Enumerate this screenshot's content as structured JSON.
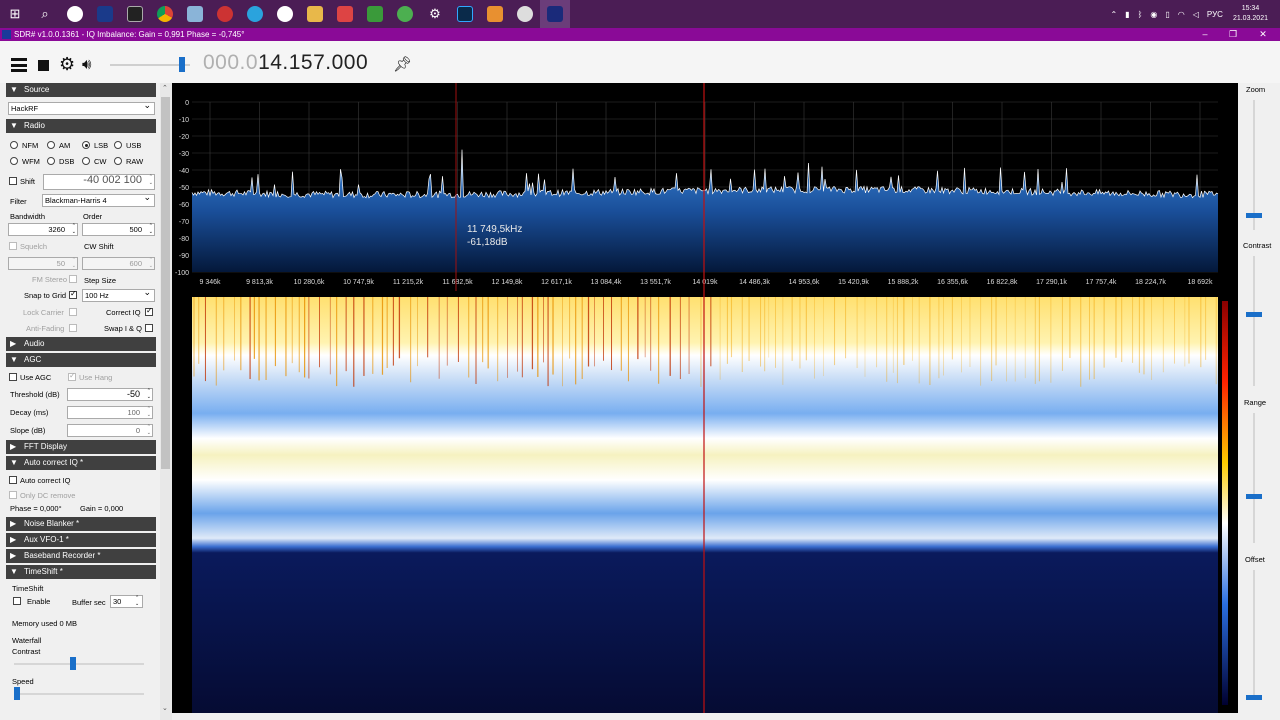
{
  "taskbar": {
    "icons": [
      "windows-start-icon",
      "search-icon",
      "app-icon",
      "app-icon",
      "terminal-icon",
      "chrome-icon",
      "app-icon",
      "app-icon",
      "telegram-icon",
      "yandex-icon",
      "folder-icon",
      "app-icon",
      "app-icon",
      "app-icon",
      "settings-icon",
      "photoshop-icon",
      "app-icon",
      "app-icon",
      "sdr-icon"
    ],
    "tray_lang": "РУС",
    "time": "15:34",
    "date": "21.03.2021"
  },
  "window": {
    "title": "SDR# v1.0.0.1361 - IQ Imbalance: Gain = 0,991 Phase = -0,745°"
  },
  "toolbar": {
    "freq_dim": "000.0",
    "freq_bright": "14.157.000"
  },
  "sidebar": {
    "source": {
      "header": "Source",
      "device": "HackRF"
    },
    "radio": {
      "header": "Radio",
      "modes": [
        "NFM",
        "AM",
        "LSB",
        "USB",
        "WFM",
        "DSB",
        "CW",
        "RAW"
      ],
      "selected": "LSB",
      "shift_label": "Shift",
      "shift_value": "-40 002 100",
      "filter_label": "Filter",
      "filter_value": "Blackman-Harris 4",
      "bandwidth_label": "Bandwidth",
      "bandwidth_value": "3260",
      "order_label": "Order",
      "order_value": "500",
      "squelch_label": "Squelch",
      "squelch_value": "50",
      "cwshift_label": "CW Shift",
      "cwshift_value": "600",
      "fmstereo_label": "FM Stereo",
      "stepsize_label": "Step Size",
      "snap_label": "Snap to Grid",
      "snap_value": "100 Hz",
      "lockcarrier_label": "Lock Carrier",
      "correctiq_label": "Correct IQ",
      "antifading_label": "Anti-Fading",
      "swapiq_label": "Swap I & Q"
    },
    "audio": {
      "header": "Audio"
    },
    "agc": {
      "header": "AGC",
      "use_agc": "Use AGC",
      "use_hang": "Use Hang",
      "threshold_label": "Threshold (dB)",
      "threshold_value": "-50",
      "decay_label": "Decay (ms)",
      "decay_value": "100",
      "slope_label": "Slope (dB)",
      "slope_value": "0"
    },
    "fft": {
      "header": "FFT Display"
    },
    "autoiq": {
      "header": "Auto correct IQ *",
      "auto_label": "Auto correct IQ",
      "dc_label": "Only DC remove",
      "phase_text": "Phase = 0,000°",
      "gain_text": "Gain = 0,000"
    },
    "noise": {
      "header": "Noise Blanker *"
    },
    "aux": {
      "header": "Aux VFO-1 *"
    },
    "baseband": {
      "header": "Baseband Recorder *"
    },
    "timeshift": {
      "header": "TimeShift *",
      "group": "TimeShift",
      "enable_label": "Enable",
      "buffer_label": "Buffer sec",
      "buffer_value": "30",
      "memory_text": "Memory used 0 MB"
    },
    "waterfall": {
      "group": "Waterfall",
      "contrast_label": "Contrast",
      "contrast_level": 0.45,
      "speed_label": "Speed",
      "speed_level": 0.0
    }
  },
  "spectrum": {
    "db_ticks": [
      "0",
      "-10",
      "-20",
      "-30",
      "-40",
      "-50",
      "-60",
      "-70",
      "-80",
      "-90",
      "-100"
    ],
    "freq_ticks": [
      "9 346k",
      "9 813,3k",
      "10 280,6k",
      "10 747,9k",
      "11 215,2k",
      "11 682,5k",
      "12 149,8k",
      "12 617,1k",
      "13 084,4k",
      "13 551,7k",
      "14 019k",
      "14 486,3k",
      "14 953,6k",
      "15 420,9k",
      "15 888,2k",
      "16 355,6k",
      "16 822,8k",
      "17 290,1k",
      "17 757,4k",
      "18 224,7k",
      "18 692k"
    ],
    "cursor_freq": "11 749,5kHz",
    "cursor_level": "-61,18dB",
    "floor_db": -53,
    "colors": {
      "trace": "#ffffff",
      "fill_top": "#2f77c9",
      "fill_bottom": "#041a40",
      "marker": "#c01010"
    }
  },
  "right_panel": {
    "zoom_label": "Zoom",
    "zoom_level": 0.1,
    "contrast_label": "Contrast",
    "contrast_level": 0.55,
    "range_label": "Range",
    "range_level": 0.35,
    "offset_label": "Offset",
    "offset_level": 0.0
  }
}
